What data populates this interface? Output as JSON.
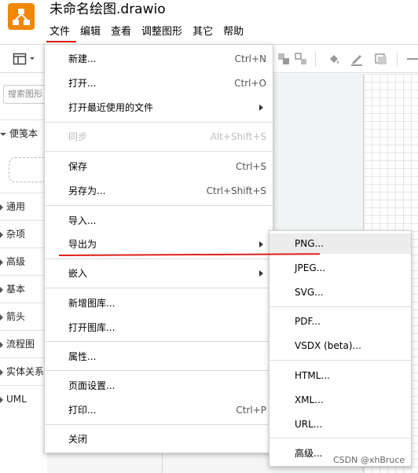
{
  "header": {
    "title": "未命名绘图.drawio",
    "menu": [
      "文件",
      "编辑",
      "查看",
      "调整图形",
      "其它",
      "帮助"
    ]
  },
  "sidebar": {
    "search_placeholder": "搜索图形",
    "sections": [
      "便笺本",
      "通用",
      "杂项",
      "高级",
      "基本",
      "箭头",
      "流程图",
      "实体关系",
      "UML"
    ]
  },
  "file_menu": {
    "items": [
      {
        "label": "新建...",
        "shortcut": "Ctrl+N"
      },
      {
        "label": "打开...",
        "shortcut": "Ctrl+O"
      },
      {
        "label": "打开最近使用的文件",
        "submenu": true
      },
      {
        "label": "同步",
        "shortcut": "Alt+Shift+S",
        "disabled": true
      },
      {
        "label": "保存",
        "shortcut": "Ctrl+S"
      },
      {
        "label": "另存为...",
        "shortcut": "Ctrl+Shift+S"
      },
      {
        "label": "导入..."
      },
      {
        "label": "导出为",
        "submenu": true
      },
      {
        "label": "嵌入",
        "submenu": true
      },
      {
        "label": "新增图库..."
      },
      {
        "label": "打开图库..."
      },
      {
        "label": "属性..."
      },
      {
        "label": "页面设置..."
      },
      {
        "label": "打印...",
        "shortcut": "Ctrl+P"
      },
      {
        "label": "关闭"
      }
    ]
  },
  "export_menu": {
    "items": [
      "PNG...",
      "JPEG...",
      "SVG...",
      "PDF...",
      "VSDX (beta)...",
      "HTML...",
      "XML...",
      "URL...",
      "高级..."
    ],
    "highlighted": "PNG..."
  },
  "watermark": "CSDN @xhBruce",
  "colors": {
    "logo": "#f08705",
    "annotation_underline": "#e0201e",
    "menu_highlight": "#ececec"
  }
}
